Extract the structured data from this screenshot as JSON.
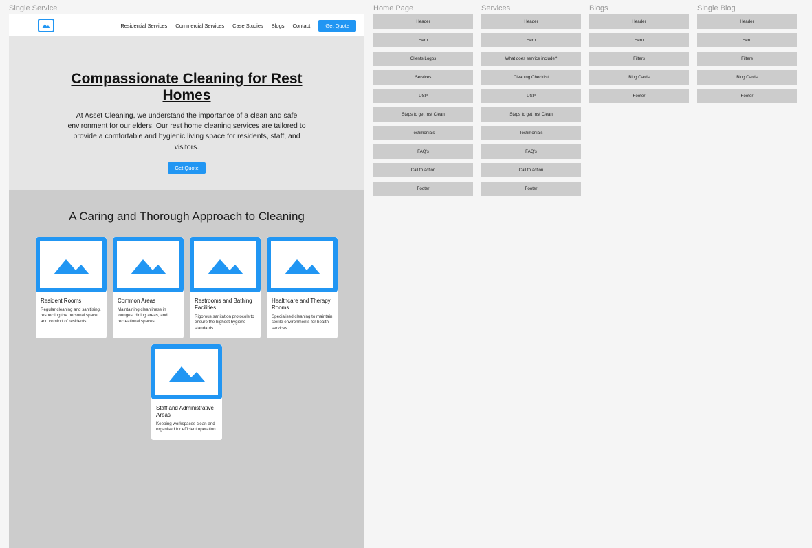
{
  "singleService": {
    "label": "Single Service",
    "nav": {
      "links": [
        "Residential Services",
        "Commercial Services",
        "Case Studies",
        "Blogs",
        "Contact"
      ],
      "cta": "Get Quote"
    },
    "hero": {
      "title": "Compassionate Cleaning for Rest Homes",
      "body": "At Asset Cleaning, we understand the importance of a clean and safe environment for our elders. Our rest home cleaning services are tailored to provide a comfortable and hygienic living space for residents, staff, and visitors.",
      "cta": "Get Quote"
    },
    "section2": {
      "heading": "A Caring and Thorough Approach to Cleaning",
      "cards": [
        {
          "title": "Resident Rooms",
          "desc": "Regular cleaning and sanitising, respecting the personal space and comfort of residents."
        },
        {
          "title": "Common Areas",
          "desc": "Maintaining cleanliness in lounges, dining areas, and recreational spaces."
        },
        {
          "title": "Restrooms and Bathing Facilities",
          "desc": "Rigorous sanitation protocols to ensure the highest hygiene standards."
        },
        {
          "title": "Healthcare and Therapy Rooms",
          "desc": "Specialised cleaning to maintain sterile environments for health services."
        },
        {
          "title": "Staff and Administrative Areas",
          "desc": "Keeping workspaces clean and organised for efficient operation."
        }
      ]
    }
  },
  "columns": {
    "home": {
      "label": "Home Page",
      "blocks": [
        "Header",
        "Hero",
        "Clients Logos",
        "Services",
        "USP",
        "Steps to get Inst Clean",
        "Testimonials",
        "FAQ's",
        "Call to action",
        "Footer"
      ]
    },
    "services": {
      "label": "Services",
      "blocks": [
        "Header",
        "Hero",
        "What does service include?",
        "Cleaning Checklist",
        "USP",
        "Steps to get Inst Clean",
        "Testimonials",
        "FAQ's",
        "Call to action",
        "Footer"
      ]
    },
    "blogs": {
      "label": "Blogs",
      "blocks": [
        "Header",
        "Hero",
        "Filters",
        "Blog Cards",
        "Footer"
      ]
    },
    "singleBlog": {
      "label": "Single Blog",
      "blocks": [
        "Header",
        "Hero",
        "Filters",
        "Blog Cards",
        "Footer"
      ]
    }
  }
}
